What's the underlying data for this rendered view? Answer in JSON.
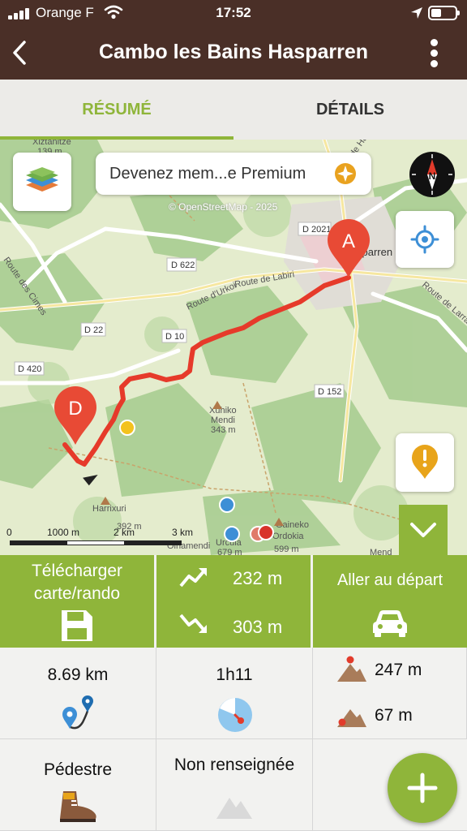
{
  "status_bar": {
    "carrier": "Orange F",
    "time": "17:52"
  },
  "header": {
    "title": "Cambo les Bains Hasparren"
  },
  "tabs": [
    {
      "label": "RÉSUMÉ",
      "active": true
    },
    {
      "label": "DÉTAILS",
      "active": false
    }
  ],
  "map": {
    "premium_banner": "Devenez mem...e Premium",
    "attribution": "© OpenStreetMap - 2025",
    "start_marker": "A",
    "end_marker": "D",
    "labels": {
      "xiztanitze": "Xiztanitze",
      "xiz_alt": "139 m",
      "d2021": "D 2021",
      "d622": "D 622",
      "d22": "D 22",
      "d10": "D 10",
      "d420": "D 420",
      "d152": "D 152",
      "route_labiri": "Route de Labiri",
      "route_urkoi": "Route d'Urkoi",
      "route_cimes": "Route des Cimes",
      "route_hasparren": "Route de Hasparren",
      "route_larrart": "Route de Larrart",
      "hasparren": "sparren",
      "xuhiko": "Xuhiko",
      "mendi": "Mendi",
      "xuhiko_alt": "343 m",
      "harrixuri": "Harrixuri",
      "harrixuri_alt": "392 m",
      "olhamendi": "Olhamendi",
      "urcuia": "Urcuia",
      "urcuia_alt": "679 m",
      "gaineko": "Gaineko",
      "ordokia": "Ordokia",
      "ordokia_alt": "599 m",
      "mend": "Mend"
    },
    "scale": {
      "zero": "0",
      "s1": "1000 m",
      "s2": "2 km",
      "s3": "3 km"
    },
    "colors": {
      "route": "#e63a2a",
      "marker": "#e84a35",
      "accent": "#8fb53a"
    }
  },
  "actions": {
    "download_line1": "Télécharger",
    "download_line2": "carte/rando",
    "elevation_gain": "232 m",
    "elevation_loss": "303 m",
    "go_to_start": "Aller au départ"
  },
  "stats": {
    "distance": "8.69 km",
    "duration": "1h11",
    "alt_max": "247 m",
    "alt_min": "67 m",
    "activity": "Pédestre",
    "difficulty": "Non renseignée"
  }
}
